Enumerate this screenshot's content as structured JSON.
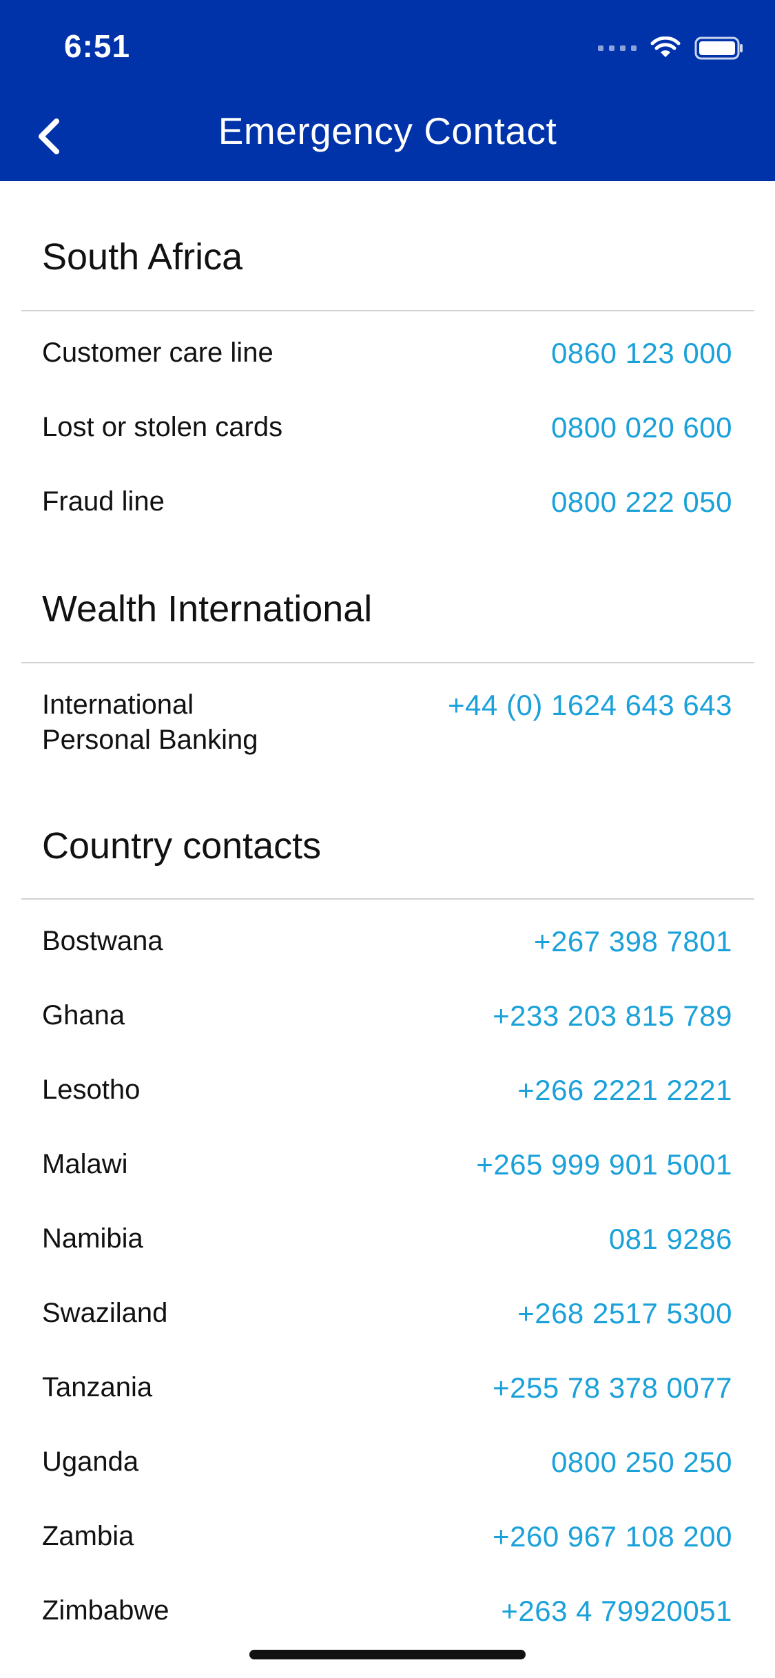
{
  "status_bar": {
    "time": "6:51"
  },
  "nav": {
    "title": "Emergency Contact"
  },
  "sections": {
    "south_africa": {
      "title": "South Africa",
      "rows": [
        {
          "label": "Customer care line",
          "phone": "0860 123 000"
        },
        {
          "label": "Lost or stolen cards",
          "phone": "0800 020 600"
        },
        {
          "label": "Fraud line",
          "phone": "0800 222 050"
        }
      ]
    },
    "wealth": {
      "title": "Wealth International",
      "rows": [
        {
          "label_line1": "International",
          "label_line2": "Personal Banking",
          "phone": "+44 (0) 1624 643 643"
        }
      ]
    },
    "country": {
      "title": "Country contacts",
      "rows": [
        {
          "label": "Bostwana",
          "phone": "+267 398 7801"
        },
        {
          "label": "Ghana",
          "phone": "+233 203 815 789"
        },
        {
          "label": "Lesotho",
          "phone": "+266 2221 2221"
        },
        {
          "label": "Malawi",
          "phone": "+265 999 901 5001"
        },
        {
          "label": "Namibia",
          "phone": "081 9286"
        },
        {
          "label": "Swaziland",
          "phone": "+268 2517 5300"
        },
        {
          "label": "Tanzania",
          "phone": "+255 78 378 0077"
        },
        {
          "label": "Uganda",
          "phone": "0800 250 250"
        },
        {
          "label": "Zambia",
          "phone": "+260 967 108 200"
        },
        {
          "label": "Zimbabwe",
          "phone": "+263 4 79920051"
        }
      ]
    }
  },
  "colors": {
    "header": "#0033AA",
    "phone": "#1AA1D9",
    "divider": "#D2D2D6"
  },
  "icons": {
    "back": "chevron-left-icon",
    "wifi": "wifi-icon",
    "battery": "battery-icon",
    "signal": "cellular-signal-icon"
  }
}
